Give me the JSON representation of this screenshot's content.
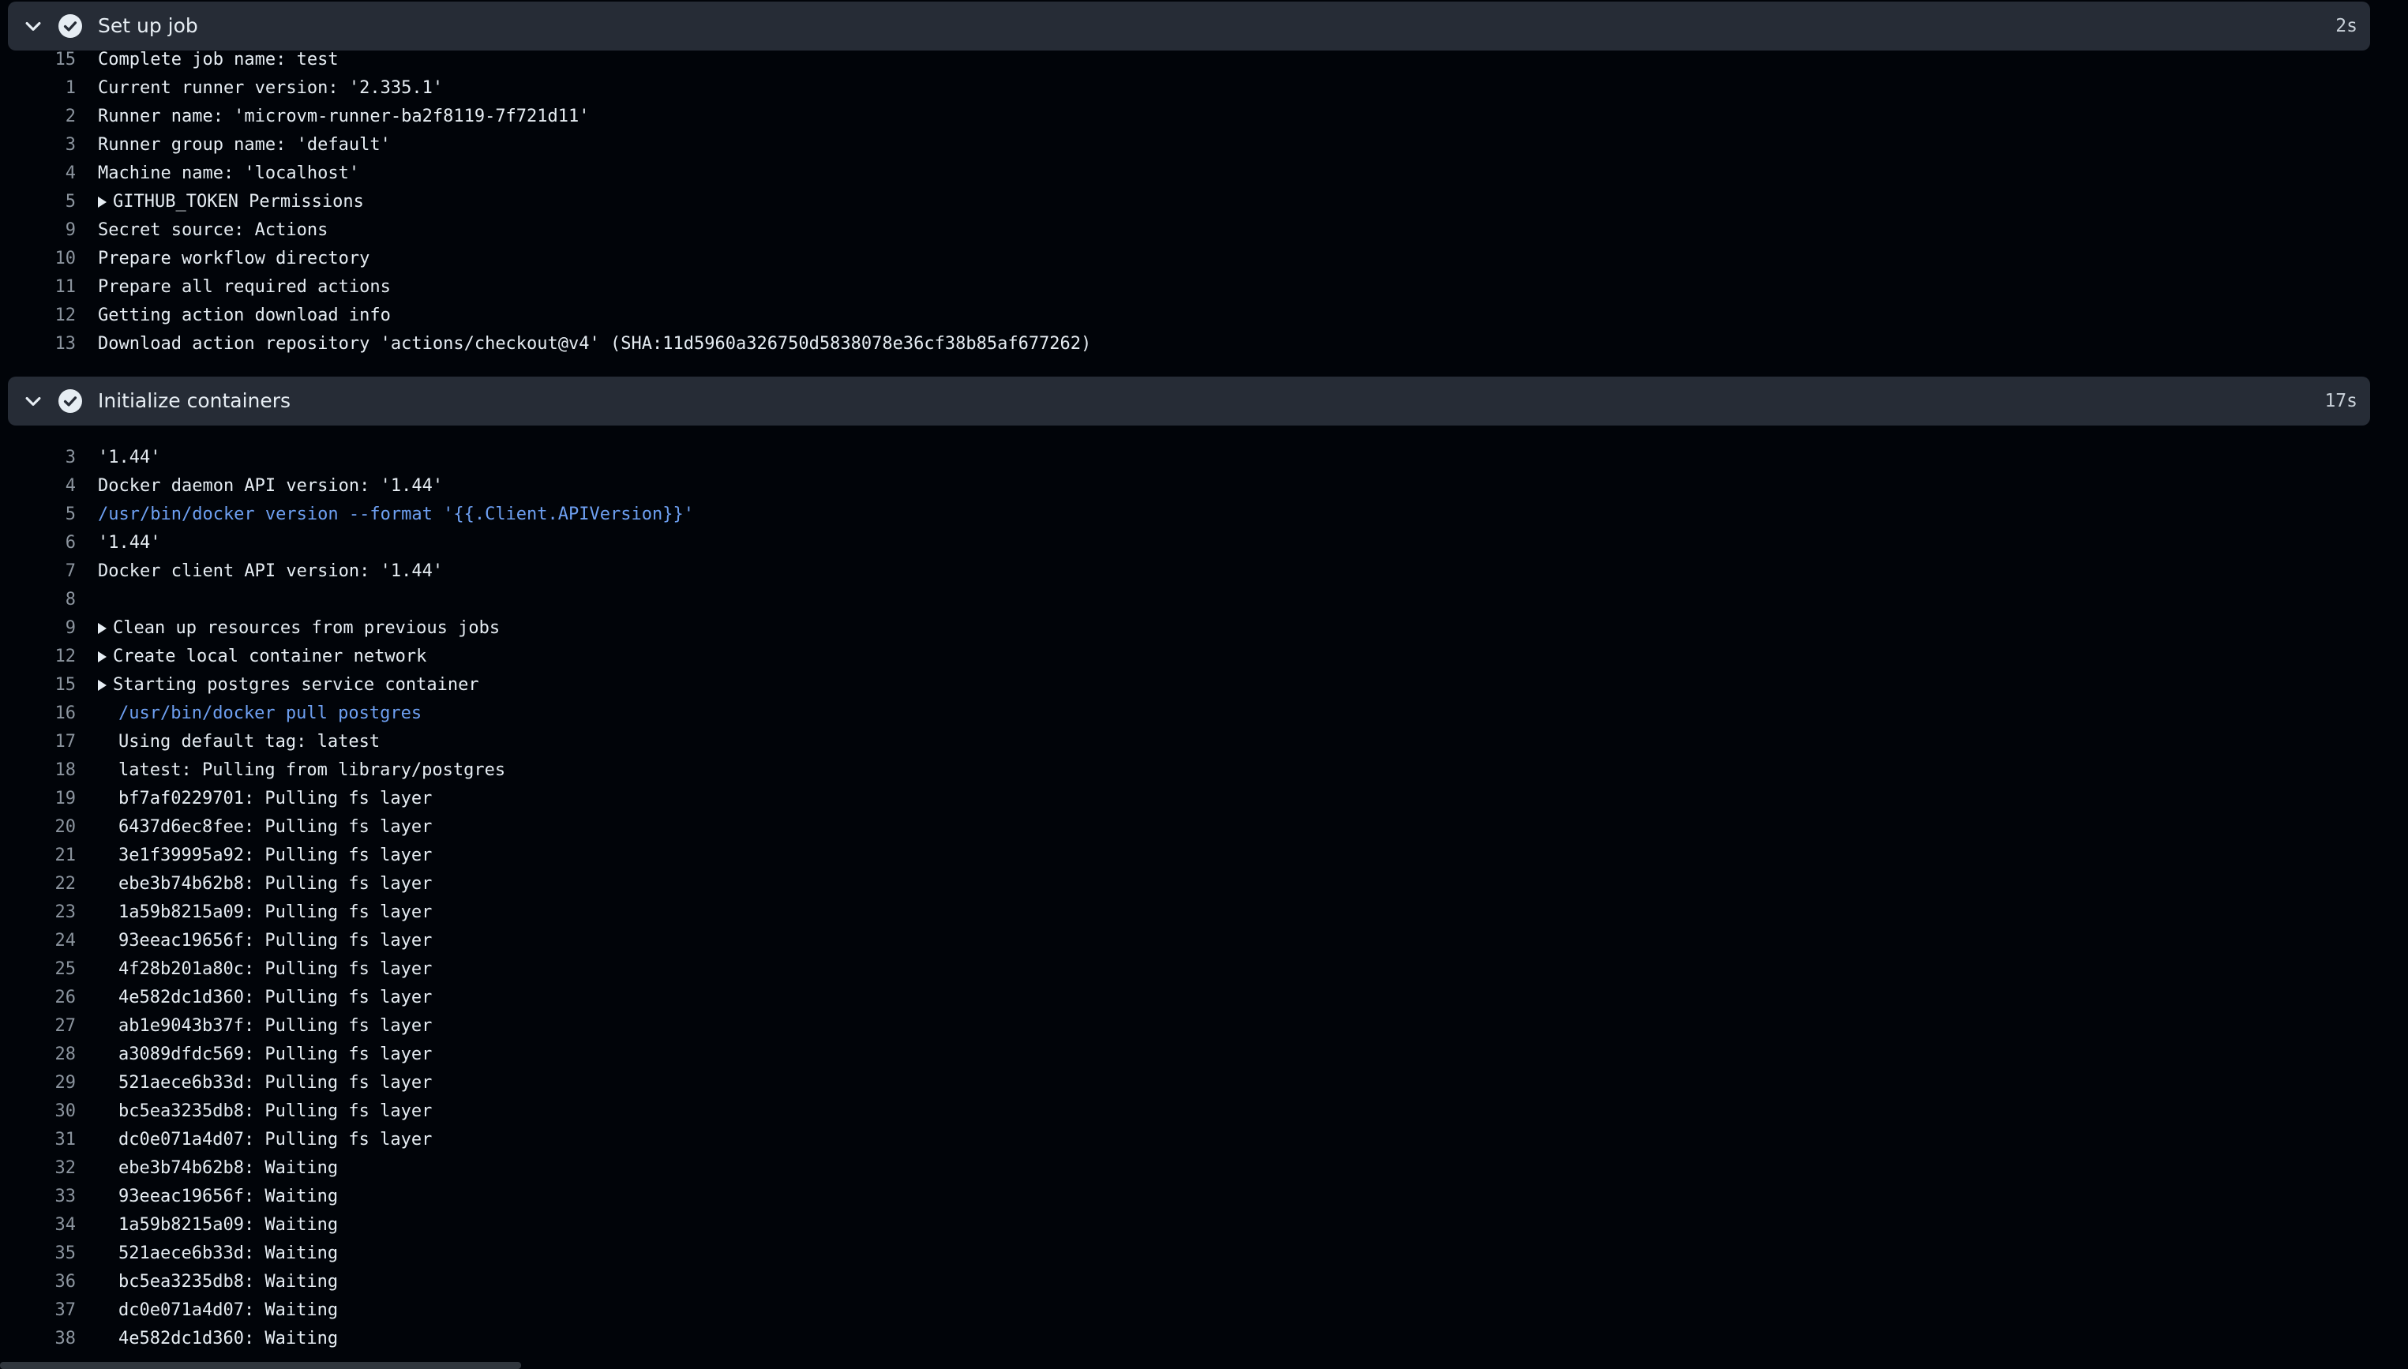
{
  "steps": [
    {
      "title": "Set up job",
      "duration": "2s",
      "status": "success",
      "lines": [
        {
          "num": "15",
          "text": "Complete job name: test",
          "kind": "plain"
        },
        {
          "num": "1",
          "text": "Current runner version: '2.335.1'",
          "kind": "plain"
        },
        {
          "num": "2",
          "text": "Runner name: 'microvm-runner-ba2f8119-7f721d11'",
          "kind": "plain"
        },
        {
          "num": "3",
          "text": "Runner group name: 'default'",
          "kind": "plain"
        },
        {
          "num": "4",
          "text": "Machine name: 'localhost'",
          "kind": "plain"
        },
        {
          "num": "5",
          "text": "GITHUB_TOKEN Permissions",
          "kind": "group"
        },
        {
          "num": "9",
          "text": "Secret source: Actions",
          "kind": "plain"
        },
        {
          "num": "10",
          "text": "Prepare workflow directory",
          "kind": "plain"
        },
        {
          "num": "11",
          "text": "Prepare all required actions",
          "kind": "plain"
        },
        {
          "num": "12",
          "text": "Getting action download info",
          "kind": "plain"
        },
        {
          "num": "13",
          "text": "Download action repository 'actions/checkout@v4' (SHA:11d5960a326750d5838078e36cf38b85af677262)",
          "kind": "plain"
        }
      ]
    },
    {
      "title": "Initialize containers",
      "duration": "17s",
      "status": "success",
      "lines": [
        {
          "num": "3",
          "text": "'1.44'",
          "kind": "plain"
        },
        {
          "num": "4",
          "text": "Docker daemon API version: '1.44'",
          "kind": "plain"
        },
        {
          "num": "5",
          "text": "/usr/bin/docker version --format '{{.Client.APIVersion}}'",
          "kind": "command"
        },
        {
          "num": "6",
          "text": "'1.44'",
          "kind": "plain"
        },
        {
          "num": "7",
          "text": "Docker client API version: '1.44'",
          "kind": "plain"
        },
        {
          "num": "8",
          "text": "",
          "kind": "plain"
        },
        {
          "num": "9",
          "text": "Clean up resources from previous jobs",
          "kind": "group"
        },
        {
          "num": "12",
          "text": "Create local container network",
          "kind": "group"
        },
        {
          "num": "15",
          "text": "Starting postgres service container",
          "kind": "group"
        },
        {
          "num": "16",
          "text": "/usr/bin/docker pull postgres",
          "kind": "command-indent"
        },
        {
          "num": "17",
          "text": "Using default tag: latest",
          "kind": "indent"
        },
        {
          "num": "18",
          "text": "latest: Pulling from library/postgres",
          "kind": "indent"
        },
        {
          "num": "19",
          "text": "bf7af0229701: Pulling fs layer",
          "kind": "indent"
        },
        {
          "num": "20",
          "text": "6437d6ec8fee: Pulling fs layer",
          "kind": "indent"
        },
        {
          "num": "21",
          "text": "3e1f39995a92: Pulling fs layer",
          "kind": "indent"
        },
        {
          "num": "22",
          "text": "ebe3b74b62b8: Pulling fs layer",
          "kind": "indent"
        },
        {
          "num": "23",
          "text": "1a59b8215a09: Pulling fs layer",
          "kind": "indent"
        },
        {
          "num": "24",
          "text": "93eeac19656f: Pulling fs layer",
          "kind": "indent"
        },
        {
          "num": "25",
          "text": "4f28b201a80c: Pulling fs layer",
          "kind": "indent"
        },
        {
          "num": "26",
          "text": "4e582dc1d360: Pulling fs layer",
          "kind": "indent"
        },
        {
          "num": "27",
          "text": "ab1e9043b37f: Pulling fs layer",
          "kind": "indent"
        },
        {
          "num": "28",
          "text": "a3089dfdc569: Pulling fs layer",
          "kind": "indent"
        },
        {
          "num": "29",
          "text": "521aece6b33d: Pulling fs layer",
          "kind": "indent"
        },
        {
          "num": "30",
          "text": "bc5ea3235db8: Pulling fs layer",
          "kind": "indent"
        },
        {
          "num": "31",
          "text": "dc0e071a4d07: Pulling fs layer",
          "kind": "indent"
        },
        {
          "num": "32",
          "text": "ebe3b74b62b8: Waiting",
          "kind": "indent"
        },
        {
          "num": "33",
          "text": "93eeac19656f: Waiting",
          "kind": "indent"
        },
        {
          "num": "34",
          "text": "1a59b8215a09: Waiting",
          "kind": "indent"
        },
        {
          "num": "35",
          "text": "521aece6b33d: Waiting",
          "kind": "indent"
        },
        {
          "num": "36",
          "text": "bc5ea3235db8: Waiting",
          "kind": "indent"
        },
        {
          "num": "37",
          "text": "dc0e071a4d07: Waiting",
          "kind": "indent"
        },
        {
          "num": "38",
          "text": "4e582dc1d360: Waiting",
          "kind": "indent"
        }
      ]
    }
  ],
  "icons": {
    "collapse": "chevron-down-icon",
    "status": "check-circle-icon",
    "group": "triangle-right-icon"
  },
  "colors": {
    "background": "#010409",
    "header": "#262c36",
    "text": "#e6edf3",
    "line_number": "#8b949e",
    "command": "#6ea0f2"
  }
}
